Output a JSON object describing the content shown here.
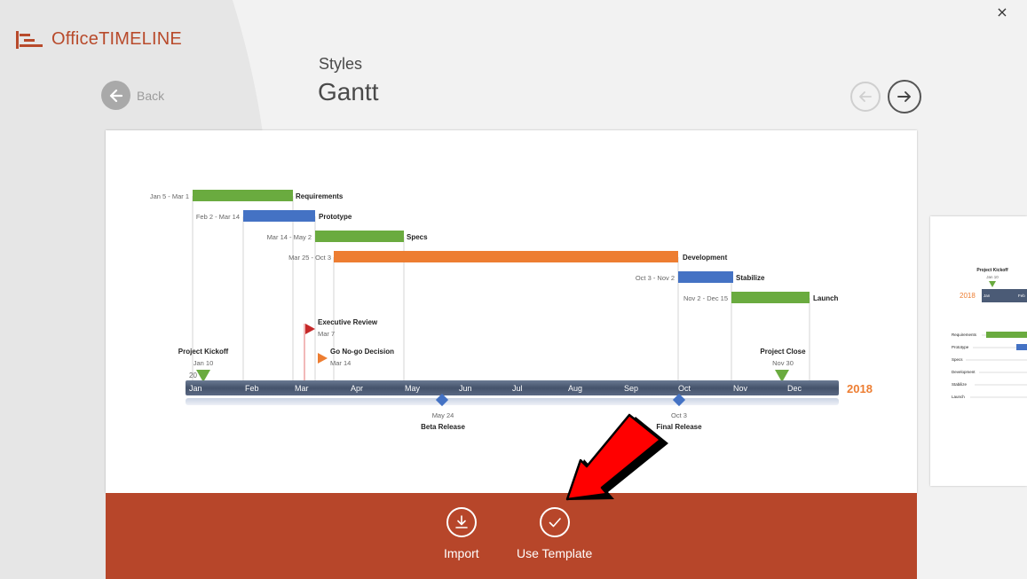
{
  "app": {
    "logo_text_a": "Office",
    "logo_text_b": "TIMELINE",
    "close_glyph": "×"
  },
  "nav": {
    "back_label": "Back"
  },
  "header": {
    "section_label": "Styles",
    "style_name": "Gantt"
  },
  "colors": {
    "accent": "#b7462a",
    "green": "#6aab3f",
    "blue": "#4472c4",
    "orange": "#ed7d31",
    "axis": "#4b5b76"
  },
  "preview": {
    "year": "2018",
    "months": [
      "Jan",
      "Feb",
      "Mar",
      "Apr",
      "May",
      "Jun",
      "Jul",
      "Aug",
      "Sep",
      "Oct",
      "Nov",
      "Dec"
    ],
    "tasks": [
      {
        "dates": "Jan 5 - Mar 1",
        "name": "Requirements",
        "color": "green"
      },
      {
        "dates": "Feb 2 - Mar 14",
        "name": "Prototype",
        "color": "blue"
      },
      {
        "dates": "Mar 14 - May 2",
        "name": "Specs",
        "color": "green"
      },
      {
        "dates": "Mar 25 - Oct 3",
        "name": "Development",
        "color": "orange"
      },
      {
        "dates": "Oct 3 - Nov 2",
        "name": "Stabilize",
        "color": "blue"
      },
      {
        "dates": "Nov 2 - Dec 15",
        "name": "Launch",
        "color": "green"
      }
    ],
    "milestones_above": [
      {
        "name": "Executive Review",
        "date": "Mar 7"
      },
      {
        "name": "Go No-go Decision",
        "date": "Mar 14"
      },
      {
        "name": "Project Kickoff",
        "date": "Jan 10",
        "extra": "20"
      },
      {
        "name": "Project Close",
        "date": "Nov 30"
      }
    ],
    "milestones_below": [
      {
        "name": "Beta Release",
        "date": "May 24"
      },
      {
        "name": "Final Release",
        "date": "Oct 3"
      }
    ]
  },
  "side_preview": {
    "milestone_name": "Project Kickoff",
    "milestone_date": "Jan 10",
    "year": "2018",
    "months": [
      "Jan",
      "Feb"
    ],
    "tasks": [
      "Requirements",
      "Prototype",
      "Specs",
      "Development",
      "Stabilize",
      "Launch"
    ]
  },
  "actions": {
    "import_label": "Import",
    "use_template_label": "Use Template"
  }
}
